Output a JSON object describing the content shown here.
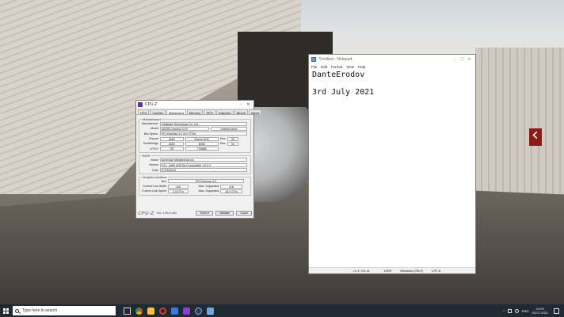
{
  "cpuz": {
    "title": "CPU-Z",
    "tabs": [
      "CPU",
      "Caches",
      "Mainboard",
      "Memory",
      "SPD",
      "Graphics",
      "Bench",
      "About"
    ],
    "active_tab": "Mainboard",
    "motherboard_group": "Motherboard",
    "manufacturer_label": "Manufacturer",
    "manufacturer": "Gigabyte Technology Co. Ltd.",
    "model_label": "Model",
    "model": "AB350-Gaming 3-CF",
    "model_extra": "Default string",
    "bus_specs_label": "Bus Specs.",
    "bus_specs": "PCI-Express 3.0 (8.0 GT/s)",
    "chipset_label": "Chipset",
    "chipset_vendor": "AMD",
    "chipset_model": "Ryzen SOC",
    "chipset_rev_label": "Rev.",
    "chipset_rev": "00",
    "southbridge_label": "Southbridge",
    "southbridge_vendor": "AMD",
    "southbridge_model": "B350",
    "southbridge_rev_label": "Rev.",
    "southbridge_rev": "51",
    "lpcio_label": "LPCIO",
    "lpcio_vendor": "ITE",
    "lpcio_model": "IT8686",
    "bios_group": "BIOS",
    "brand_label": "Brand",
    "bios_brand": "American Megatrends Inc.",
    "version_label": "Version",
    "bios_version": "F41 - AMD AGESA ComboAM4 1.0.0.3",
    "date_label": "Date",
    "bios_date": "07/20/2019",
    "graphic_group": "Graphic Interface",
    "bus_label": "Bus",
    "graphic_bus": "PCI-Express 4.0",
    "link_width_label": "Current Link Width",
    "link_width": "x16",
    "max_supported_label": "Max. Supported",
    "max_link_width": "x16",
    "link_speed_label": "Current Link Speed",
    "link_speed": "2.5 GT/s",
    "max_link_speed": "16.0 GT/s",
    "brand_text": "CPU-Z",
    "version_text": "Ver. 1.95.0.x64",
    "tools_label": "Tools",
    "validate_label": "Validate",
    "close_label": "Close"
  },
  "notepad": {
    "title": "*Untitled - Notepad",
    "menu": [
      "File",
      "Edit",
      "Format",
      "View",
      "Help"
    ],
    "content": "DanteErodov\n\n3rd July 2021",
    "status_position": "Ln 3, Col 14",
    "status_zoom": "100%",
    "status_eol": "Windows (CRLF)",
    "status_encoding": "UTF-8"
  },
  "taskbar": {
    "search_placeholder": "Type here to search",
    "icons": [
      "task-view-icon",
      "chrome-icon",
      "file-explorer-icon",
      "opera-icon",
      "store-icon",
      "cpuz-icon",
      "steam-icon",
      "notepad-icon"
    ],
    "language": "ENG",
    "time": "14:03",
    "date": "03-07-2021"
  },
  "colors": {
    "taskbar_bg": "#1f2a33",
    "cpuz_logo": "#6b2fb0",
    "notepad_icon": "#5d9bd6"
  }
}
